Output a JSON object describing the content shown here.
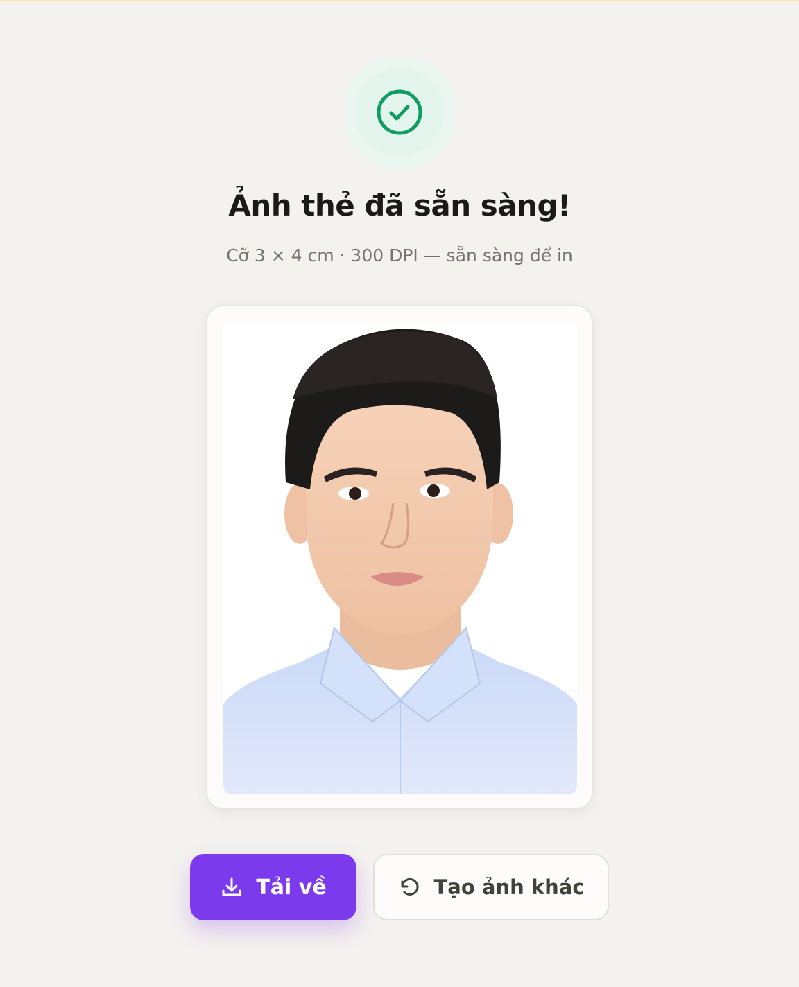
{
  "status": {
    "icon": "check-circle-icon",
    "title": "Ảnh thẻ đã sẵn sàng!",
    "subtitle": "Cỡ 3 × 4 cm · 300 DPI — sẵn sàng để in"
  },
  "photo": {
    "description_icon": "portrait-photo"
  },
  "actions": {
    "download_label": "Tải về",
    "download_icon": "download-icon",
    "redo_label": "Tạo ảnh khác",
    "redo_icon": "rotate-ccw-icon"
  },
  "colors": {
    "accent": "#7c3aed",
    "success": "#0f9d63",
    "background": "#f4f2ef"
  }
}
